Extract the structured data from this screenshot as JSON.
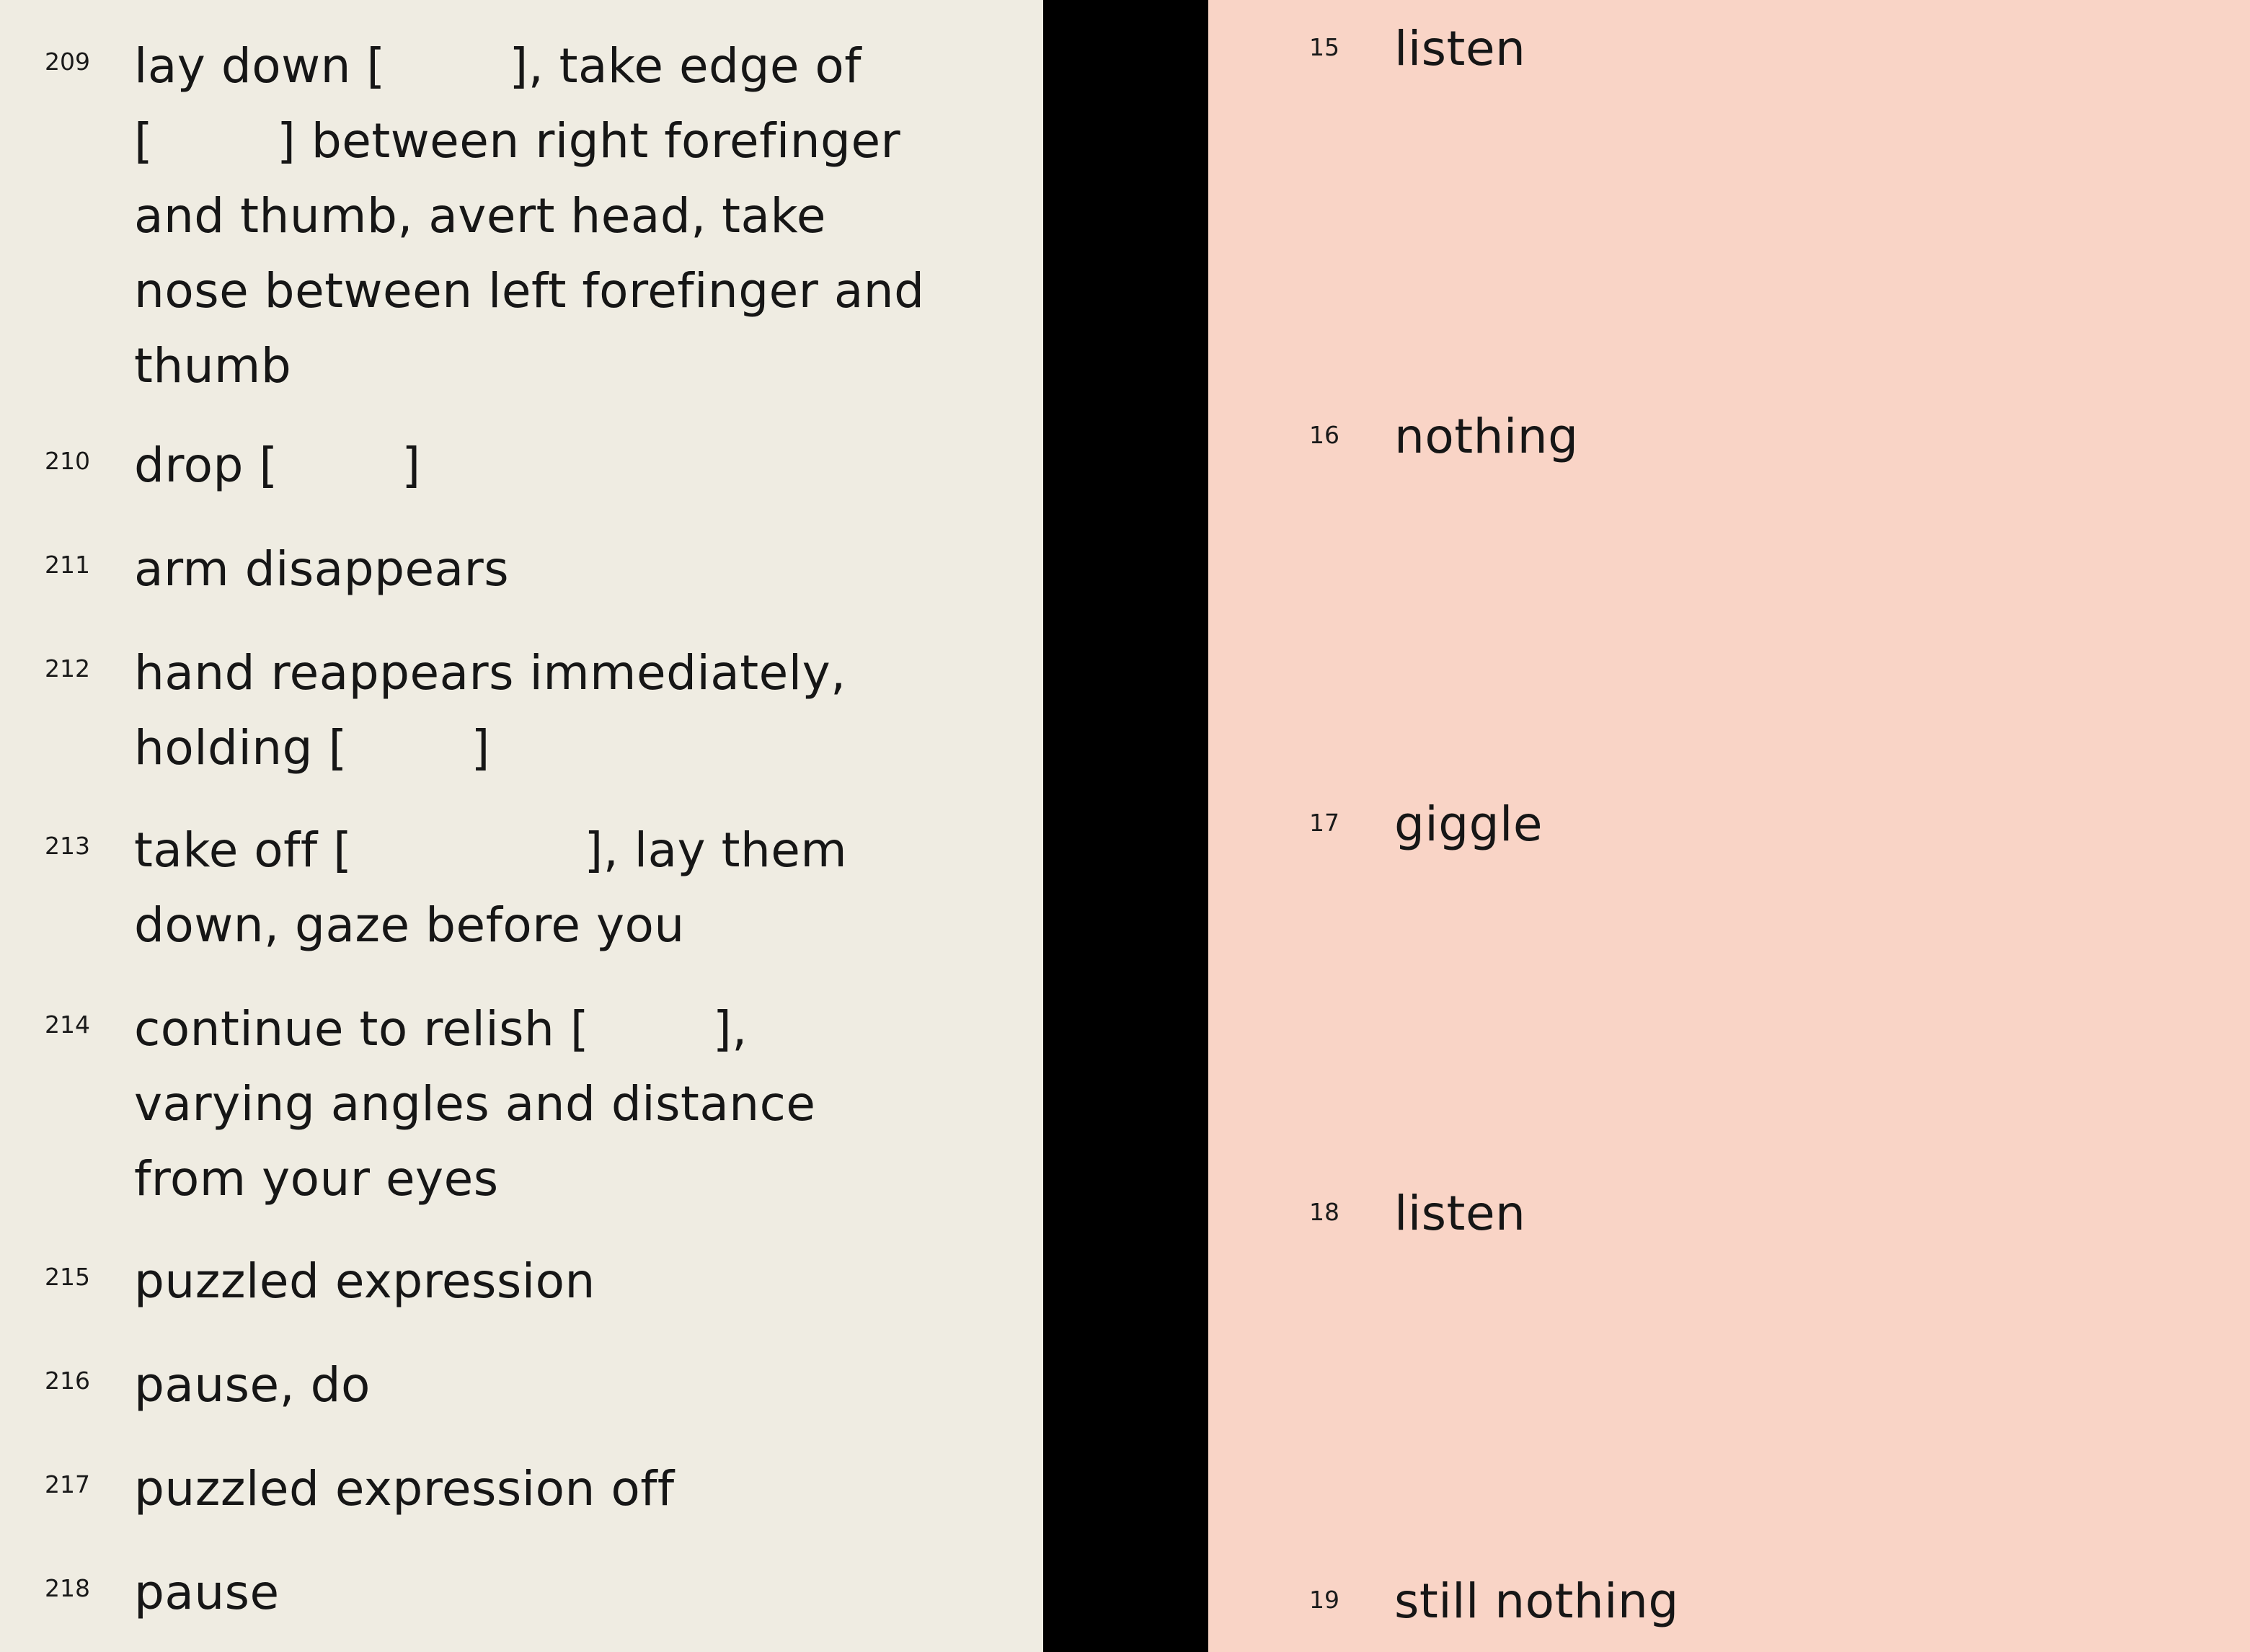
{
  "colors": {
    "left_page_bg": "#efece2",
    "right_page_bg": "#f9d4c6",
    "gutter": "#000000",
    "ink": "#161616"
  },
  "left_page": {
    "entries": [
      {
        "number": "209",
        "text": "lay down [        ], take edge of\n[        ] between right forefinger\nand thumb, avert head, take\nnose between left forefinger and\nthumb"
      },
      {
        "number": "210",
        "text": "drop [        ]"
      },
      {
        "number": "211",
        "text": "arm disappears"
      },
      {
        "number": "212",
        "text": "hand reappears immediately,\nholding [        ]"
      },
      {
        "number": "213",
        "text": "take off [               ], lay them\ndown, gaze before you"
      },
      {
        "number": "214",
        "text": "continue to relish [        ],\nvarying angles and distance\nfrom your eyes"
      },
      {
        "number": "215",
        "text": "puzzled expression"
      },
      {
        "number": "216",
        "text": "pause, do"
      },
      {
        "number": "217",
        "text": "puzzled expression off"
      },
      {
        "number": "218",
        "text": "pause"
      }
    ]
  },
  "right_page": {
    "entries": [
      {
        "number": "15",
        "text": "listen"
      },
      {
        "number": "16",
        "text": "nothing"
      },
      {
        "number": "17",
        "text": "giggle"
      },
      {
        "number": "18",
        "text": "listen"
      },
      {
        "number": "19",
        "text": "still nothing"
      }
    ]
  }
}
